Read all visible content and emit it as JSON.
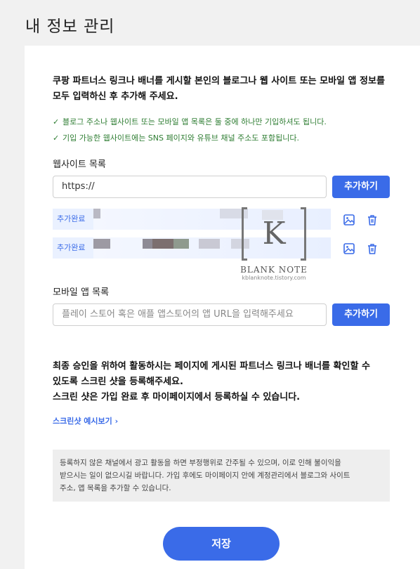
{
  "page_title": "내 정보 관리",
  "intro": {
    "line1": "쿠팡 파트너스 링크나 배너를 게시할 본인의 블로그나 웹 사이트 또는 모바일 앱 정보를",
    "line2": "모두 입력하신 후 추가해 주세요."
  },
  "checks": [
    {
      "icon": "check-icon",
      "text": "블로그 주소나 웹사이트 또는 모바일 앱 목록은 둘 중에 하나만 기입하셔도 됩니다."
    },
    {
      "icon": "check-icon",
      "text": "기입 가능한 웹사이트에는 SNS 페이지와 유튜브 채널 주소도 포함됩니다."
    }
  ],
  "website": {
    "label": "웹사이트 목록",
    "value": "https://",
    "add_label": "추가하기",
    "items": [
      {
        "tag": "추가완료",
        "icons": [
          "image-icon",
          "trash-icon"
        ]
      },
      {
        "tag": "추가완료",
        "icons": [
          "image-icon",
          "trash-icon"
        ]
      }
    ]
  },
  "mobile": {
    "label": "모바일 앱 목록",
    "placeholder": "플레이 스토어 혹은 애플 앱스토어의 앱 URL을 입력해주세요",
    "add_label": "추가하기"
  },
  "watermark": {
    "letter": "K",
    "name": "BLANK NOTE",
    "url": "kblanknote.tistory.com"
  },
  "screenshot_note": {
    "line1": "최종 승인을 위하여 활동하시는 페이지에 게시된 파트너스 링크나 배너를 확인할 수",
    "line2": "있도록 스크린 샷을 등록해주세요.",
    "line3": "스크린 샷은 가입 완료 후 마이페이지에서 등록하실 수 있습니다."
  },
  "preview_link": "스크린샷 예시보기 ›",
  "info": {
    "line1": "등록하지 않은 채널에서 광고 활동을 하면 부정행위로 간주될 수 있으며, 이로 인해 불이익을",
    "line2": "받으시는 일이 없으시길 바랍니다. 가입 후에도 마이페이지 안에 계정관리에서 블로그와 사이트",
    "line3": "주소, 앱 목록을 추가할 수 있습니다."
  },
  "save_label": "저장",
  "colors": {
    "accent": "#3a6be8",
    "check": "#2e7d32",
    "tag_bg": "#eaf1ff"
  }
}
